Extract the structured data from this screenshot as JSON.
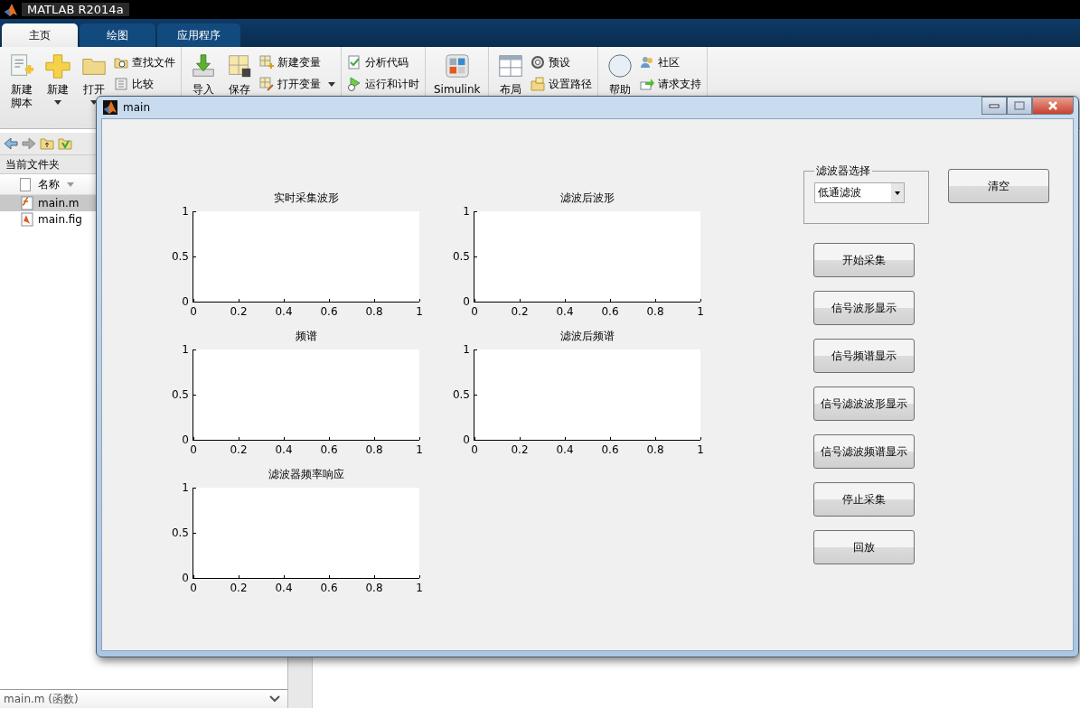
{
  "app": {
    "title": "MATLAB R2014a"
  },
  "ribbon_tabs": [
    {
      "label": "主页",
      "selected": true
    },
    {
      "label": "绘图",
      "selected": false
    },
    {
      "label": "应用程序",
      "selected": false
    }
  ],
  "ribbon_sections": [
    {
      "items": [
        {
          "kind": "large",
          "lines": [
            "新建",
            "脚本"
          ],
          "dropdown": false
        },
        {
          "kind": "large",
          "lines": [
            "新建"
          ],
          "dropdown": true
        },
        {
          "kind": "large",
          "lines": [
            "打开"
          ],
          "dropdown": true
        },
        {
          "kind": "small",
          "lines": [
            "查找文件"
          ],
          "dropdown": false
        },
        {
          "kind": "small",
          "lines": [
            "比较"
          ],
          "dropdown": false
        }
      ]
    },
    {
      "items": [
        {
          "kind": "large",
          "lines": [
            "导入"
          ],
          "dropdown": false
        },
        {
          "kind": "large",
          "lines": [
            "保存"
          ],
          "dropdown": false
        },
        {
          "kind": "small",
          "lines": [
            "新建变量"
          ],
          "dropdown": false
        },
        {
          "kind": "small",
          "lines": [
            "打开变量"
          ],
          "dropdown": true
        }
      ]
    },
    {
      "items": [
        {
          "kind": "small",
          "lines": [
            "分析代码"
          ],
          "dropdown": false
        },
        {
          "kind": "small",
          "lines": [
            "运行和计时"
          ],
          "dropdown": false
        }
      ]
    },
    {
      "items": [
        {
          "kind": "large",
          "lines": [
            "Simulink"
          ],
          "dropdown": false
        }
      ]
    },
    {
      "items": [
        {
          "kind": "large",
          "lines": [
            "布局"
          ],
          "dropdown": false
        },
        {
          "kind": "small",
          "lines": [
            "预设"
          ],
          "dropdown": false
        },
        {
          "kind": "small",
          "lines": [
            "设置路径"
          ],
          "dropdown": false
        }
      ]
    },
    {
      "items": [
        {
          "kind": "large",
          "lines": [
            "帮助"
          ],
          "dropdown": false
        },
        {
          "kind": "small",
          "lines": [
            "社区"
          ],
          "dropdown": false
        },
        {
          "kind": "small",
          "lines": [
            "请求支持"
          ],
          "dropdown": false
        }
      ]
    }
  ],
  "current_folder": {
    "title": "当前文件夹",
    "column": "名称",
    "files": [
      {
        "name": "main.m",
        "selected": true
      },
      {
        "name": "main.fig",
        "selected": false
      }
    ],
    "details": "main.m (函数)"
  },
  "figure": {
    "title": "main",
    "axes": [
      {
        "title": "实时采集波形",
        "xticks": [
          "0",
          "0.2",
          "0.4",
          "0.6",
          "0.8",
          "1"
        ],
        "yticks": [
          "1",
          "0.5",
          "0"
        ]
      },
      {
        "title": "滤波后波形",
        "xticks": [
          "0",
          "0.2",
          "0.4",
          "0.6",
          "0.8",
          "1"
        ],
        "yticks": [
          "1",
          "0.5",
          "0"
        ]
      },
      {
        "title": "频谱",
        "xticks": [
          "0",
          "0.2",
          "0.4",
          "0.6",
          "0.8",
          "1"
        ],
        "yticks": [
          "1",
          "0.5",
          "0"
        ]
      },
      {
        "title": "滤波后频谱",
        "xticks": [
          "0",
          "0.2",
          "0.4",
          "0.6",
          "0.8",
          "1"
        ],
        "yticks": [
          "1",
          "0.5",
          "0"
        ]
      },
      {
        "title": "滤波器频率响应",
        "xticks": [
          "0",
          "0.2",
          "0.4",
          "0.6",
          "0.8",
          "1"
        ],
        "yticks": [
          "1",
          "0.5",
          "0"
        ]
      }
    ],
    "filter_group": {
      "label": "滤波器选择",
      "select": {
        "value": "低通滤波"
      }
    },
    "clear_button": "清空",
    "buttons": [
      "开始采集",
      "信号波形显示",
      "信号频谱显示",
      "信号滤波波形显示",
      "信号滤波频谱显示",
      "停止采集",
      "回放"
    ]
  }
}
